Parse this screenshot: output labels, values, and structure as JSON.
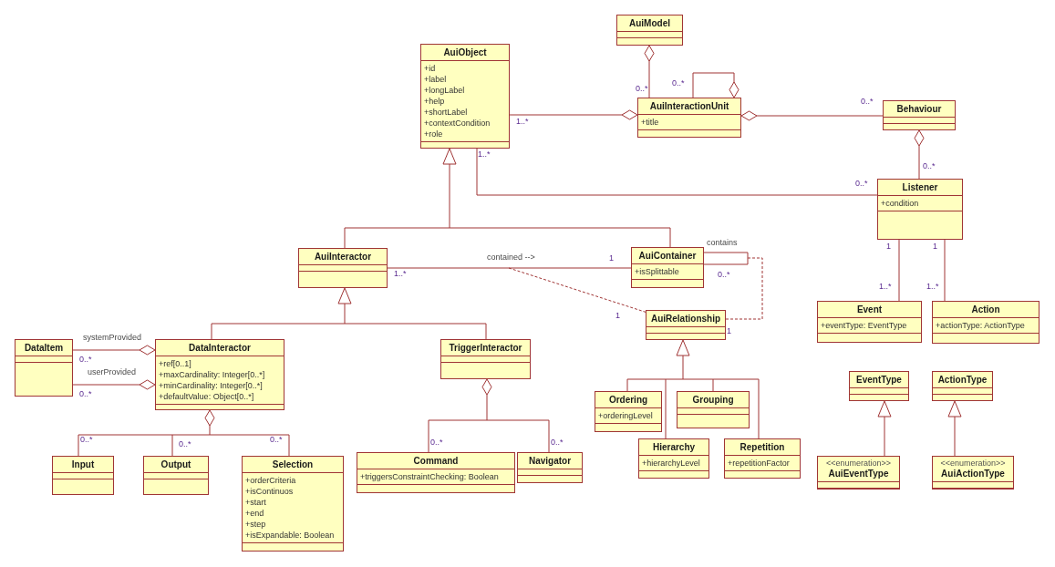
{
  "classes": [
    {
      "name": "AuiModel"
    },
    {
      "name": "AuiObject",
      "attributes": [
        "+id",
        "+label",
        "+longLabel",
        "+help",
        "+shortLabel",
        "+contextCondition",
        "+role"
      ]
    },
    {
      "name": "AuiInteractionUnit",
      "attributes": [
        "+title"
      ]
    },
    {
      "name": "Behaviour"
    },
    {
      "name": "Listener",
      "attributes": [
        "+condition"
      ]
    },
    {
      "name": "AuiInteractor"
    },
    {
      "name": "AuiContainer",
      "attributes": [
        "+isSplittable"
      ]
    },
    {
      "name": "AuiRelationship"
    },
    {
      "name": "Event",
      "attributes": [
        "+eventType: EventType"
      ]
    },
    {
      "name": "Action",
      "attributes": [
        "+actionType: ActionType"
      ]
    },
    {
      "name": "DataItem"
    },
    {
      "name": "DataInteractor",
      "attributes": [
        "+ref[0..1]",
        "+maxCardinality: Integer[0..*]",
        "+minCardinality: Integer[0..*]",
        "+defaultValue: Object[0..*]"
      ]
    },
    {
      "name": "TriggerInteractor"
    },
    {
      "name": "Ordering",
      "attributes": [
        "+orderingLevel"
      ]
    },
    {
      "name": "Grouping"
    },
    {
      "name": "EventType"
    },
    {
      "name": "ActionType"
    },
    {
      "name": "Input"
    },
    {
      "name": "Output"
    },
    {
      "name": "Selection",
      "attributes": [
        "+orderCriteria",
        "+isContinuos",
        "+start",
        "+end",
        "+step",
        "+isExpandable: Boolean"
      ]
    },
    {
      "name": "Command",
      "attributes": [
        "+triggersConstraintChecking: Boolean"
      ]
    },
    {
      "name": "Navigator"
    },
    {
      "name": "Hierarchy",
      "attributes": [
        "+hierarchyLevel"
      ]
    },
    {
      "name": "Repetition",
      "attributes": [
        "+repetitionFactor"
      ]
    },
    {
      "name": "AuiEventType",
      "stereotype": "<<enumeration>>"
    },
    {
      "name": "AuiActionType",
      "stereotype": "<<enumeration>>"
    }
  ],
  "relations": [
    {
      "kind": "aggregation",
      "labels": [
        {
          "kind": "multiplicity",
          "text": "0..*"
        }
      ]
    },
    {
      "kind": "aggregation",
      "labels": [
        {
          "kind": "multiplicity",
          "text": "0..*"
        }
      ]
    },
    {
      "kind": "aggregation",
      "labels": [
        {
          "kind": "multiplicity",
          "text": "1..*"
        }
      ]
    },
    {
      "kind": "aggregation",
      "labels": [
        {
          "kind": "multiplicity",
          "text": "0..*"
        }
      ]
    },
    {
      "kind": "aggregation",
      "labels": [
        {
          "kind": "multiplicity",
          "text": "0..*"
        }
      ]
    },
    {
      "kind": "association",
      "labels": [
        {
          "kind": "multiplicity",
          "text": "1..*"
        },
        {
          "kind": "multiplicity",
          "text": "0..*"
        }
      ]
    },
    {
      "kind": "generalization"
    },
    {
      "kind": "association",
      "labels": [
        {
          "kind": "role",
          "text": "contained -->"
        },
        {
          "kind": "multiplicity",
          "text": "1..*"
        },
        {
          "kind": "multiplicity",
          "text": "1"
        }
      ]
    },
    {
      "kind": "association",
      "labels": [
        {
          "kind": "role",
          "text": "contains"
        },
        {
          "kind": "multiplicity",
          "text": "0..*"
        }
      ]
    },
    {
      "kind": "dependency",
      "labels": [
        {
          "kind": "multiplicity",
          "text": "1"
        }
      ]
    },
    {
      "kind": "dependency",
      "labels": [
        {
          "kind": "multiplicity",
          "text": "1"
        }
      ]
    },
    {
      "kind": "association",
      "labels": [
        {
          "kind": "multiplicity",
          "text": "1"
        },
        {
          "kind": "multiplicity",
          "text": "1..*"
        }
      ]
    },
    {
      "kind": "association",
      "labels": [
        {
          "kind": "multiplicity",
          "text": "1"
        },
        {
          "kind": "multiplicity",
          "text": "1..*"
        }
      ]
    },
    {
      "kind": "generalization"
    },
    {
      "kind": "aggregation",
      "labels": [
        {
          "kind": "role",
          "text": "systemProvided"
        },
        {
          "kind": "multiplicity",
          "text": "0..*"
        }
      ]
    },
    {
      "kind": "aggregation",
      "labels": [
        {
          "kind": "role",
          "text": "userProvided"
        },
        {
          "kind": "multiplicity",
          "text": "0..*"
        }
      ]
    },
    {
      "kind": "aggregation",
      "labels": [
        {
          "kind": "multiplicity",
          "text": "0..*"
        },
        {
          "kind": "multiplicity",
          "text": "0..*"
        },
        {
          "kind": "multiplicity",
          "text": "0..*"
        }
      ]
    },
    {
      "kind": "aggregation",
      "labels": [
        {
          "kind": "multiplicity",
          "text": "0..*"
        },
        {
          "kind": "multiplicity",
          "text": "0..*"
        }
      ]
    },
    {
      "kind": "generalization"
    },
    {
      "kind": "generalization"
    },
    {
      "kind": "generalization"
    }
  ]
}
